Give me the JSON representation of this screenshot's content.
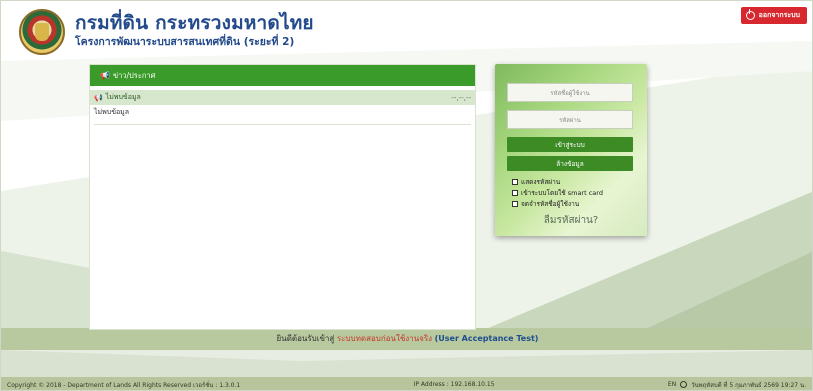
{
  "header": {
    "title": "กรมที่ดิน กระทรวงมหาดไทย",
    "subtitle": "โครงการพัฒนาระบบสารสนเทศที่ดิน (ระยะที่ 2)",
    "logout_label": "ออกจากระบบ"
  },
  "news": {
    "header_label": "ข่าว/ประกาศ",
    "sub_label": "ไม่พบข้อมูล",
    "sub_meta": "--,--,--",
    "empty_text": "ไม่พบข้อมูล"
  },
  "login": {
    "username_placeholder": "รหัสชื่อผู้ใช้งาน",
    "password_placeholder": "รหัสผ่าน",
    "login_button": "เข้าสู่ระบบ",
    "clear_button": "ล้างข้อมูล",
    "show_password_label": "แสดงรหัสผ่าน",
    "smartcard_label": "เข้าระบบโดยใช้ smart card",
    "remember_label": "จดจำรหัสชื่อผู้ใช้งาน",
    "forgot_label": "ลืมรหัสผ่าน?"
  },
  "welcome": {
    "prefix": "ยินดีต้อนรับเข้าสู่",
    "system_name": "ระบบทดสอบก่อนใช้งานจริง",
    "uat": "(User Acceptance Test)"
  },
  "footer": {
    "copyright": "Copyright © 2018 - Department of Lands All Rights Reserved เวอร์ชั่น : 1.3.0.1",
    "ip": "IP Address : 192.168.10.15",
    "lang": "EN",
    "datetime": "วันพฤหัสบดี ที่ 5 กุมภาพันธ์ 2569 19:27 น."
  },
  "colors": {
    "title_blue": "#234a8a",
    "brand_green": "#3a9a2a",
    "logout_red": "#d7282f",
    "footer_bg": "#b8c59c",
    "welcome_red": "#c23a2a"
  },
  "icons": [
    "power-icon",
    "megaphone-icon",
    "clock-icon",
    "seal-logo"
  ]
}
